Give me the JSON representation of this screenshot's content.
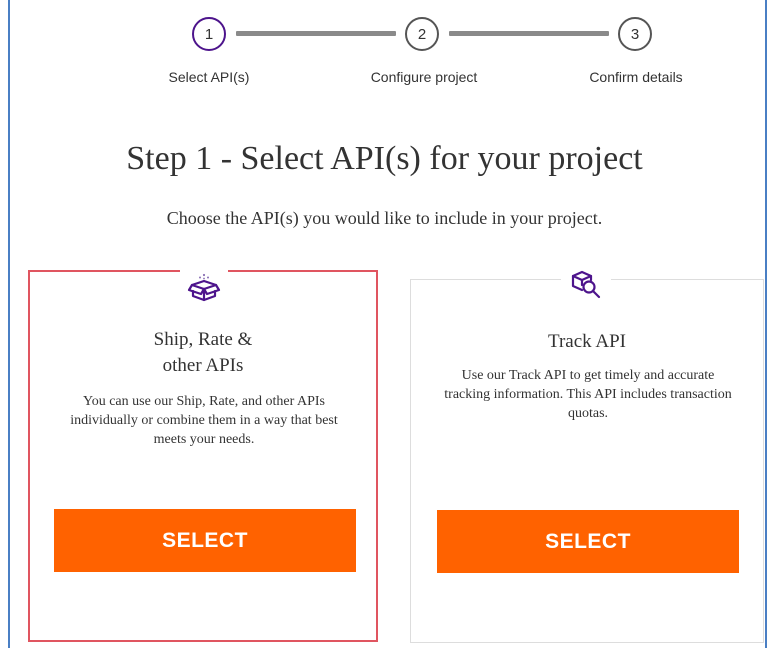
{
  "stepper": {
    "steps": [
      {
        "number": "1",
        "label": "Select API(s)",
        "state": "active"
      },
      {
        "number": "2",
        "label": "Configure project",
        "state": "inactive"
      },
      {
        "number": "3",
        "label": "Confirm details",
        "state": "inactive"
      }
    ]
  },
  "page": {
    "title": "Step 1 - Select API(s) for your project",
    "subtitle": "Choose the API(s) you would like to include in your project."
  },
  "cards": [
    {
      "icon": "open-box-icon",
      "title_line1": "Ship, Rate &",
      "title_line2": "other APIs",
      "description": "You can use our Ship, Rate, and other APIs individually or combine them in a way that best meets your needs.",
      "button_label": "SELECT",
      "selected": true
    },
    {
      "icon": "package-search-icon",
      "title_line1": "Track API",
      "description": "Use our Track API to get timely and accurate tracking information. This API includes transaction quotas.",
      "button_label": "SELECT",
      "selected": false
    }
  ],
  "colors": {
    "accent_purple": "#4d148c",
    "button_orange": "#ff6200",
    "selection_border": "#e05560",
    "frame_blue": "#4a7fc4"
  }
}
